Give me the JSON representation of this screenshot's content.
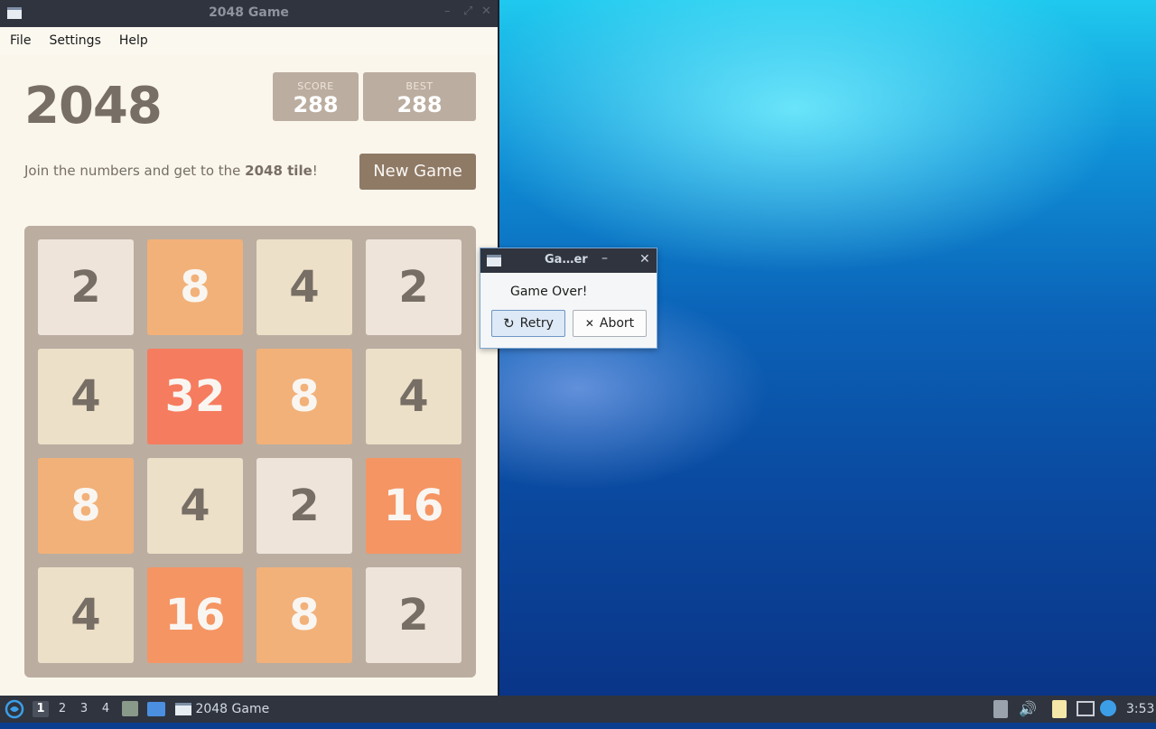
{
  "app": {
    "window_title": "2048 Game",
    "menu": [
      "File",
      "Settings",
      "Help"
    ]
  },
  "game": {
    "logo": "2048",
    "score_label": "SCORE",
    "score": "288",
    "best_label": "BEST",
    "best": "288",
    "intro_prefix": "Join the numbers and get to the ",
    "intro_bold": "2048 tile",
    "intro_suffix": "!",
    "new_game_label": "New Game",
    "board": [
      [
        "2",
        "8",
        "4",
        "2"
      ],
      [
        "4",
        "32",
        "8",
        "4"
      ],
      [
        "8",
        "4",
        "2",
        "16"
      ],
      [
        "4",
        "16",
        "8",
        "2"
      ]
    ],
    "tile_colors": {
      "2": {
        "bg": "#eee4da",
        "fg": "#776e65"
      },
      "4": {
        "bg": "#ede0c8",
        "fg": "#776e65"
      },
      "8": {
        "bg": "#f2b179",
        "fg": "#f9f6f2"
      },
      "16": {
        "bg": "#f59563",
        "fg": "#f9f6f2"
      },
      "32": {
        "bg": "#f67c5f",
        "fg": "#f9f6f2"
      }
    }
  },
  "dialog": {
    "title": "Ga…er",
    "message": "Game Over!",
    "retry_label": "Retry",
    "abort_label": "Abort"
  },
  "taskbar": {
    "workspaces": [
      "1",
      "2",
      "3",
      "4"
    ],
    "active_workspace": "1",
    "task_label": "2048 Game",
    "clock": "3:53"
  }
}
